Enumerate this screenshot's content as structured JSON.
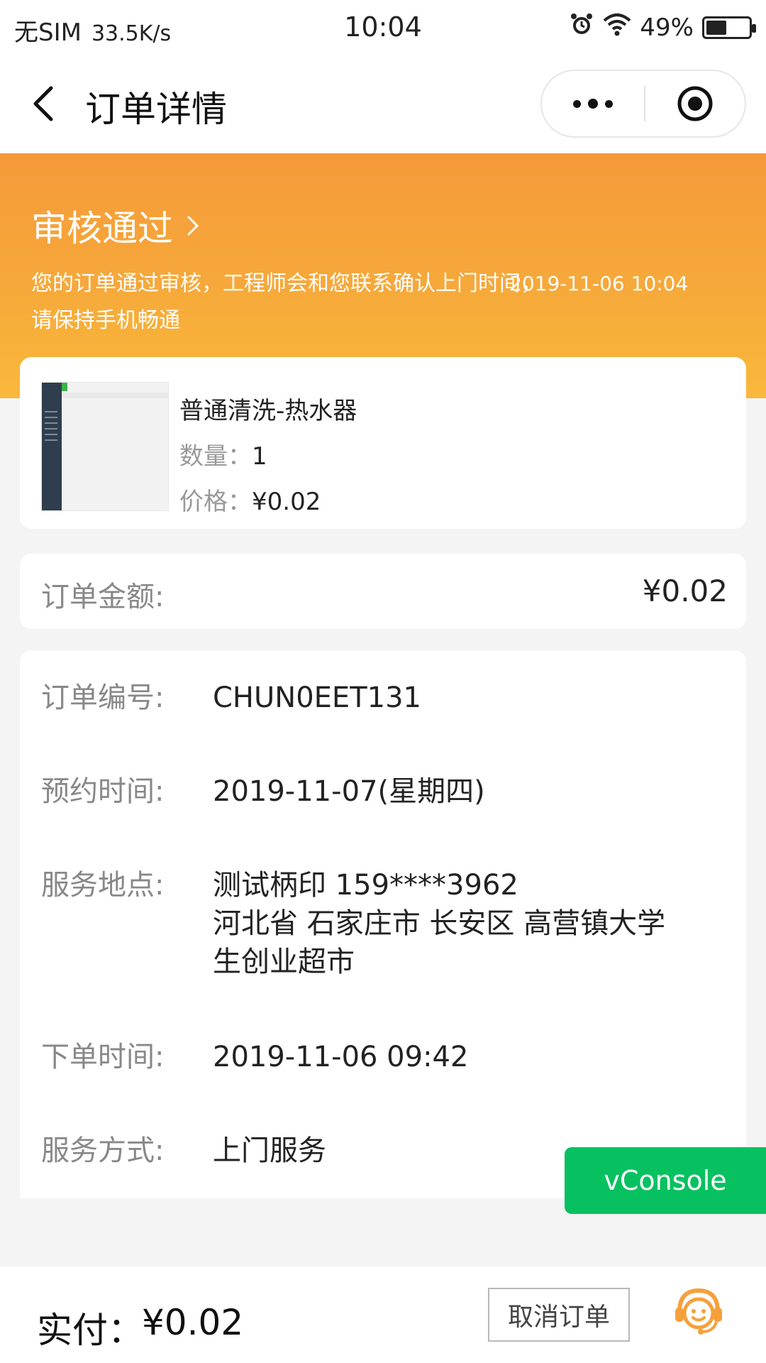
{
  "status_bar": {
    "carrier": "无SIM",
    "speed": "33.5K/s",
    "time": "10:04",
    "battery": "49%",
    "battery_level": 0.49
  },
  "nav": {
    "title": "订单详情"
  },
  "order_status": {
    "title": "审核通过",
    "description": "您的订单通过审核，工程师会和您联系确认上门时间，请保持手机畅通",
    "timestamp": "2019-11-06 10:04"
  },
  "product": {
    "name": "普通清洗-热水器",
    "quantity_label": "数量：",
    "quantity": "1",
    "price_label": "价格：",
    "price": "¥0.02"
  },
  "amount": {
    "label": "订单金额:",
    "value": "¥0.02"
  },
  "info": [
    {
      "label": "订单编号:",
      "value": "CHUN0EET131"
    },
    {
      "label": "预约时间:",
      "value": "2019-11-07(星期四)"
    },
    {
      "label": "服务地点:",
      "value": "测试柄印 159****3962",
      "value2": "河北省 石家庄市 长安区 高营镇大学",
      "value3": "生创业超市"
    },
    {
      "label": "下单时间:",
      "value": "2019-11-06 09:42"
    },
    {
      "label": "服务方式:",
      "value": "上门服务"
    }
  ],
  "vconsole_label": "vConsole",
  "footer": {
    "pay_label": "实付：",
    "pay_value": "¥0.02",
    "cancel_label": "取消订单"
  },
  "colors": {
    "banner_start": "#f59a3a",
    "banner_end": "#f9b83b",
    "vconsole_green": "#07c160",
    "service_orange": "#f5a03a"
  }
}
